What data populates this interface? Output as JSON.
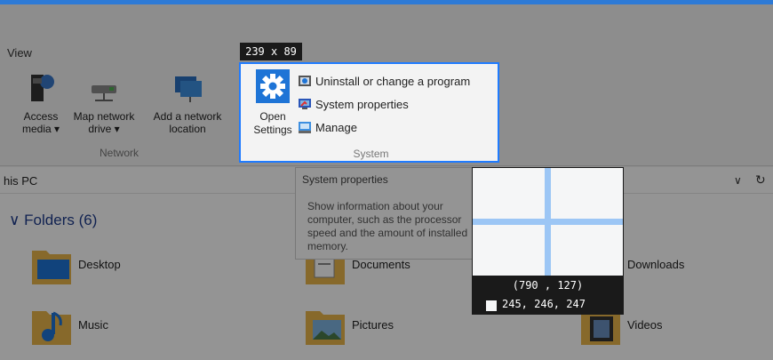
{
  "ribbon": {
    "view_tab": "View",
    "network_group": {
      "label": "Network",
      "buttons": [
        {
          "label": "Access media ▾",
          "icon": "media-icon"
        },
        {
          "label": "Map network drive ▾",
          "icon": "network-drive-icon"
        },
        {
          "label": "Add a network location",
          "icon": "network-location-icon"
        }
      ]
    },
    "system_group": {
      "label": "System",
      "open_settings": "Open Settings",
      "items": [
        {
          "label": "Uninstall or change a program",
          "icon": "uninstall-icon"
        },
        {
          "label": "System properties",
          "icon": "system-properties-icon"
        },
        {
          "label": "Manage",
          "icon": "manage-icon"
        }
      ]
    }
  },
  "address_bar": {
    "path": "his PC"
  },
  "tooltip": {
    "title": "System properties",
    "body": "Show information about your computer, such as the processor speed and the amount of installed memory."
  },
  "folders": {
    "header": "Folders (6)",
    "items": [
      {
        "name": "Desktop"
      },
      {
        "name": "Documents"
      },
      {
        "name": "Downloads"
      },
      {
        "name": "Music"
      },
      {
        "name": "Pictures"
      },
      {
        "name": "Videos"
      }
    ]
  },
  "screenshot_tool": {
    "selection_size": "239 x 89",
    "cursor_coords": "(790 , 127)",
    "pixel_rgb": "245, 246, 247",
    "crosshair_color": "#9cc6f5",
    "selection_color": "#1f7bff"
  },
  "colors": {
    "accent": "#1e74d6",
    "folder": "#e8b64a"
  }
}
